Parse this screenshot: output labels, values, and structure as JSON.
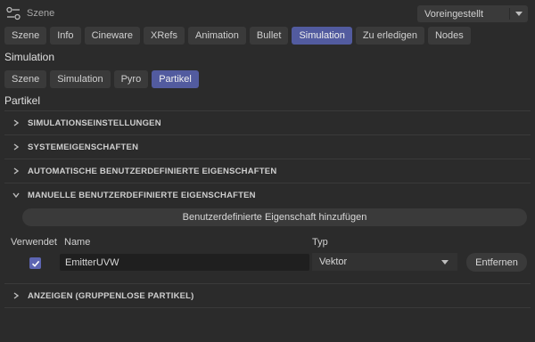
{
  "header": {
    "title": "Szene",
    "preset": "Voreingestellt"
  },
  "main_tabs": [
    {
      "label": "Szene"
    },
    {
      "label": "Info"
    },
    {
      "label": "Cineware"
    },
    {
      "label": "XRefs"
    },
    {
      "label": "Animation"
    },
    {
      "label": "Bullet"
    },
    {
      "label": "Simulation",
      "active": true
    },
    {
      "label": "Zu erledigen"
    },
    {
      "label": "Nodes"
    }
  ],
  "simulation": {
    "heading": "Simulation",
    "tabs": [
      {
        "label": "Szene"
      },
      {
        "label": "Simulation"
      },
      {
        "label": "Pyro"
      },
      {
        "label": "Partikel",
        "active": true
      }
    ]
  },
  "partikel": {
    "heading": "Partikel",
    "groups": [
      {
        "label": "SIMULATIONSEINSTELLUNGEN",
        "expanded": false
      },
      {
        "label": "SYSTEMEIGENSCHAFTEN",
        "expanded": false
      },
      {
        "label": "AUTOMATISCHE BENUTZERDEFINIERTE EIGENSCHAFTEN",
        "expanded": false
      },
      {
        "label": "MANUELLE BENUTZERDEFINIERTE EIGENSCHAFTEN",
        "expanded": true
      },
      {
        "label": "ANZEIGEN (GRUPPENLOSE PARTIKEL)",
        "expanded": false
      }
    ],
    "add_button": "Benutzerdefinierte Eigenschaft hinzufügen",
    "columns": {
      "used": "Verwendet",
      "name": "Name",
      "type": "Typ"
    },
    "property": {
      "used": true,
      "name": "EmitterUVW",
      "type": "Vektor",
      "remove_label": "Entfernen"
    }
  },
  "colors": {
    "accent": "#525b9f",
    "background": "#2b2b2b",
    "control": "#3a3a3a"
  }
}
